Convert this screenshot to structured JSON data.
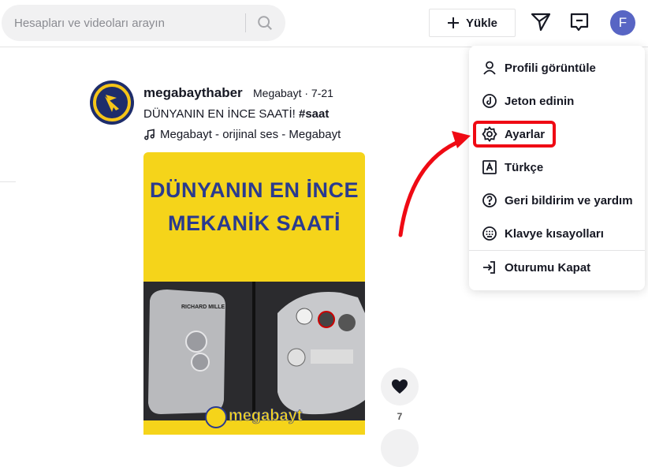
{
  "header": {
    "search_placeholder": "Hesapları ve videoları arayın",
    "upload_label": "Yükle",
    "avatar_letter": "F"
  },
  "post": {
    "username": "megabaythaber",
    "nickname_date": "Megabayt · 7-21",
    "caption_text": "DÜNYANIN EN İNCE SAATİ! ",
    "caption_tag": "#saat",
    "music": "Megabayt - orijinal ses - Megabayt",
    "video_title_line1": "DÜNYANIN EN İNCE",
    "video_title_line2": "MEKANİK SAATİ",
    "video_brand_left": "RICHARD MILLE",
    "video_logo_text": "megabayt",
    "like_count": "7"
  },
  "menu": {
    "items": [
      {
        "label": "Profili görüntüle",
        "icon": "person-icon"
      },
      {
        "label": "Jeton edinin",
        "icon": "coin-icon"
      },
      {
        "label": "Ayarlar",
        "icon": "gear-icon"
      },
      {
        "label": "Türkçe",
        "icon": "language-icon"
      },
      {
        "label": "Geri bildirim ve yardım",
        "icon": "help-icon"
      },
      {
        "label": "Klavye kısayolları",
        "icon": "keyboard-icon"
      },
      {
        "label": "Oturumu Kapat",
        "icon": "logout-icon"
      }
    ]
  },
  "colors": {
    "highlight": "#ef0a14",
    "avatar": "#5865c4",
    "video_bg": "#f5d41a",
    "video_text": "#2a3a8f"
  }
}
